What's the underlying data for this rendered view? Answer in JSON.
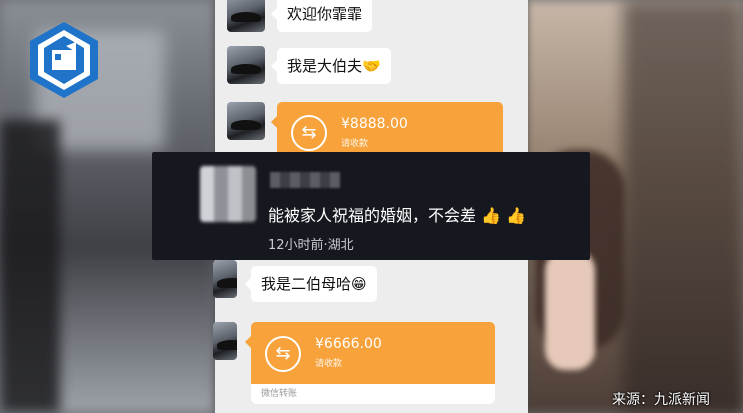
{
  "messages": {
    "m1": {
      "text": "欢迎你霏霏"
    },
    "m2": {
      "text": "我是大伯夫",
      "emoji": "🤝"
    },
    "t1": {
      "amount": "¥8888.00",
      "status": "请收款"
    },
    "m3": {
      "text": "我是二伯母哈",
      "emoji": "😁"
    },
    "t2": {
      "amount": "¥6666.00",
      "status": "请收款",
      "footer": "微信转账"
    }
  },
  "comment": {
    "text": "能被家人祝福的婚姻，不会差",
    "reactions": "👍 👍",
    "meta": "12小时前·湖北"
  },
  "source": {
    "credit": "来源：九派新闻"
  },
  "colors": {
    "transfer_orange": "#f7a23a",
    "chat_bg": "#ededed",
    "comment_bg": "#16181f",
    "logo_blue": "#1f74c9"
  },
  "icons": [
    "transfer-arrows-icon",
    "news-logo-icon"
  ]
}
